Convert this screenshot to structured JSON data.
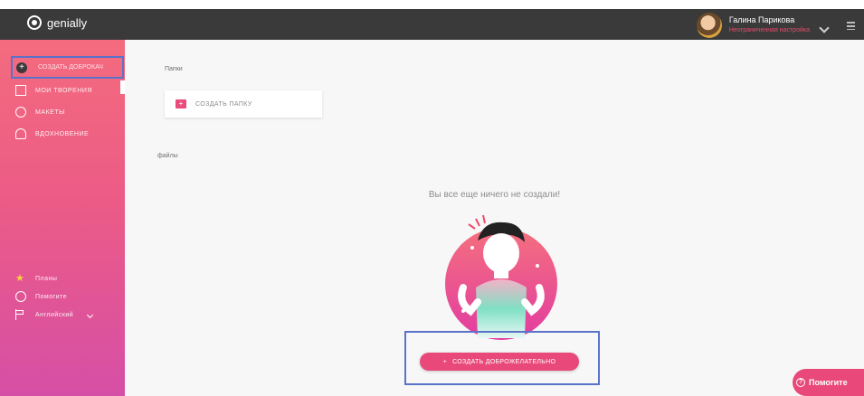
{
  "app": {
    "logo_text": "genially"
  },
  "user": {
    "name": "Галина Парикова",
    "role": "Неограниченная настройка"
  },
  "sidebar": {
    "create_label": "СОЗДАТЬ ДОБРОКАЧ",
    "items": [
      {
        "label": "МОИ ТВОРЕНИЯ",
        "icon": "creations-icon"
      },
      {
        "label": "МАКЕТЫ",
        "icon": "search-icon"
      },
      {
        "label": "ВДОХНОВЕНИЕ",
        "icon": "inspiration-icon"
      }
    ],
    "footer": [
      {
        "label": "Планы",
        "icon": "star-icon"
      },
      {
        "label": "Помогите",
        "icon": "help-circle-icon"
      },
      {
        "label": "Английский",
        "icon": "flag-icon"
      }
    ]
  },
  "main": {
    "folders_title": "Папки",
    "create_folder_label": "СОЗДАТЬ ПАПКУ",
    "files_title": "файлы",
    "empty_message": "Вы все еще ничего не создали!",
    "cta_label": "СОЗДАТЬ ДОБРОЖЕЛАТЕЛЬНО"
  },
  "help": {
    "label": "Помогите"
  },
  "colors": {
    "accent": "#e8497a",
    "topbar": "#3a3a3a",
    "highlight": "#5b72c9"
  }
}
